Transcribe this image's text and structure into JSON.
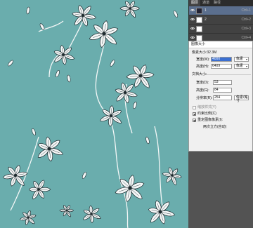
{
  "layers_panel": {
    "tabs": [
      "图层",
      "通道",
      "路径"
    ],
    "layers": [
      {
        "name": "1",
        "extra": "Ctrl+1",
        "selected": true
      },
      {
        "name": "2",
        "extra": "Ctrl+2",
        "selected": false
      },
      {
        "name": "",
        "extra": "Ctrl+3",
        "selected": false
      },
      {
        "name": "",
        "extra": "Ctrl+4",
        "selected": false
      }
    ]
  },
  "dialog": {
    "title": "图像大小",
    "pixel_dims": "像素大小:32.3M",
    "width_label": "宽度(W):",
    "width_value": "4000",
    "height_label": "高度(H):",
    "height_value": "6409",
    "pixel_unit": "像素",
    "doc_size_label": "文档大小:",
    "doc_width_label": "宽度(D):",
    "doc_width_value": "53",
    "doc_height_label": "高度(G):",
    "doc_height_value": "84",
    "resolution_label": "分辨率(R):",
    "resolution_value": "254",
    "res_unit": "像素/英寸",
    "scale_styles": "缩放样式(Y)",
    "constrain": "约束比例(C)",
    "resample": "重定图像像素(I):",
    "resample_method": "两次立方(自动)"
  },
  "colors": {
    "canvas_bg": "#6aadad",
    "flower_fill": "#f4f7f7",
    "flower_stroke": "#1e2a2e"
  }
}
